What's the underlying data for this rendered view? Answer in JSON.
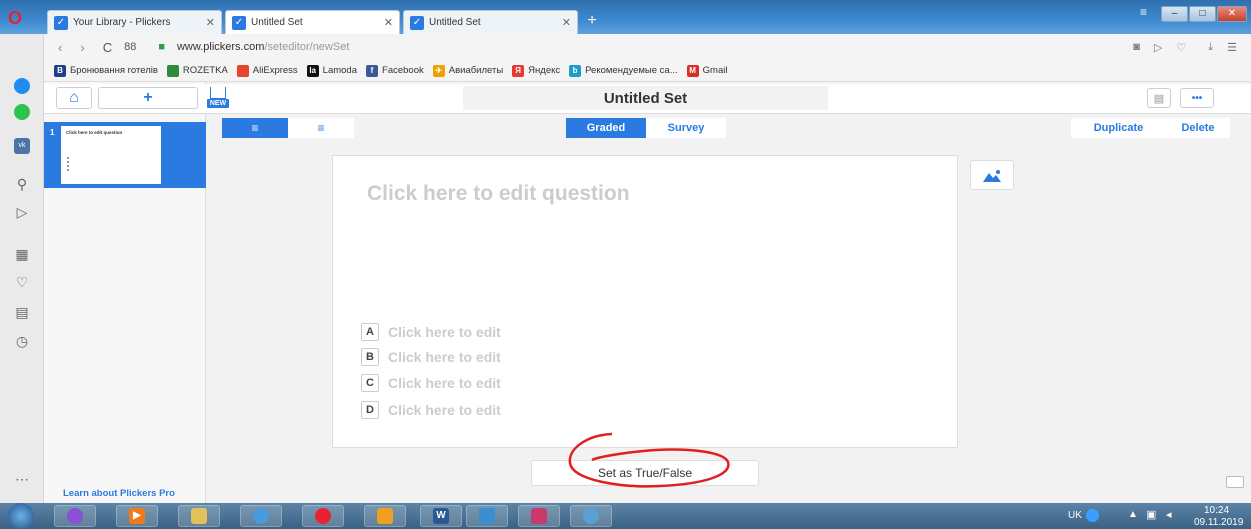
{
  "tabs": [
    {
      "title": "Your Library - Plickers",
      "active": false
    },
    {
      "title": "Untitled Set",
      "active": true
    },
    {
      "title": "Untitled Set",
      "active": false
    }
  ],
  "window_controls": {
    "minimize": "–",
    "maximize": "□",
    "close": "✕"
  },
  "address": {
    "domain": "www.plickers.com",
    "path": "/seteditor/newSet",
    "speed_dial": "88"
  },
  "bookmarks": [
    {
      "label": "Бронювання готелів",
      "icon": "booking-icon",
      "color": "#1e3f8a",
      "glyph": "B"
    },
    {
      "label": "ROZETKA",
      "icon": "rozetka-icon",
      "color": "#2e8b3d",
      "glyph": ""
    },
    {
      "label": "AliExpress",
      "icon": "aliexpress-icon",
      "color": "#e8432c",
      "glyph": ""
    },
    {
      "label": "Lamoda",
      "icon": "lamoda-icon",
      "color": "#111111",
      "glyph": "la"
    },
    {
      "label": "Facebook",
      "icon": "facebook-icon",
      "color": "#3b5998",
      "glyph": "f"
    },
    {
      "label": "Авиабилеты",
      "icon": "plane-icon",
      "color": "#f0a000",
      "glyph": "✈"
    },
    {
      "label": "Яндекс",
      "icon": "yandex-icon",
      "color": "#e53935",
      "glyph": "Я"
    },
    {
      "label": "Рекомендуемые са...",
      "icon": "recommended-icon",
      "color": "#1aa0c8",
      "glyph": "b"
    },
    {
      "label": "Gmail",
      "icon": "gmail-icon",
      "color": "#d93025",
      "glyph": "M"
    }
  ],
  "app": {
    "set_title": "Untitled Set",
    "new_badge": "NEW",
    "add_label": "+",
    "more_label": "•••",
    "mode_graded": "Graded",
    "mode_survey": "Survey",
    "duplicate": "Duplicate",
    "delete": "Delete",
    "thumb_number": "1",
    "thumb_text": "Click here to edit question",
    "learn_pro": "Learn about Plickers Pro",
    "question_placeholder": "Click here to edit question",
    "answers": [
      {
        "letter": "A",
        "text": "Click here to edit"
      },
      {
        "letter": "B",
        "text": "Click here to edit"
      },
      {
        "letter": "C",
        "text": "Click here to edit"
      },
      {
        "letter": "D",
        "text": "Click here to edit"
      }
    ],
    "true_false": "Set as True/False"
  },
  "taskbar": {
    "lang": "UK",
    "time": "10:24",
    "date": "09.11.2019"
  },
  "colors": {
    "accent": "#2a7ae2",
    "annotation": "#e02020"
  }
}
